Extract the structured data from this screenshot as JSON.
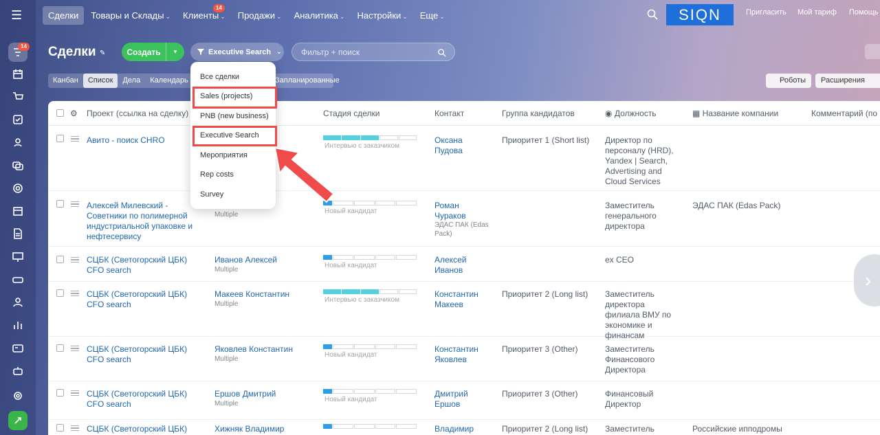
{
  "rail": {
    "badge": "14"
  },
  "topnav": {
    "items": [
      "Сделки",
      "Товары и Склады",
      "Клиенты",
      "Продажи",
      "Аналитика",
      "Настройки",
      "Еще"
    ],
    "clients_badge": "14",
    "logo": "SIQN",
    "invite": "Пригласить",
    "tariff": "Мой тариф",
    "help": "Помощь"
  },
  "header": {
    "title": "Сделки",
    "create": "Создать",
    "filter_preset": "Executive Search",
    "filter_placeholder": "Фильтр + поиск"
  },
  "views": [
    "Канбан",
    "Список",
    "Дела",
    "Календарь"
  ],
  "planned": "Запланированные",
  "robots": "Роботы",
  "extensions": "Расширения",
  "dropdown": {
    "items": [
      "Все сделки",
      "Sales (projects)",
      "PNB (new business)",
      "Executive Search",
      "Мероприятия",
      "Rep costs",
      "Survey"
    ]
  },
  "table": {
    "columns": [
      "Проект (ссылка на сделку)",
      "Стадия сделки",
      "Контакт",
      "Группа кандидатов",
      "Должность",
      "Название компании",
      "Комментарий (по ка"
    ],
    "rows": [
      {
        "project": "Авито - поиск CHRO",
        "candidate": "",
        "cand_sub": "",
        "stage": "Интервью с заказчиком",
        "contact": "Оксана Пудова",
        "contact_sub": "",
        "group": "Приоритет 1 (Short list)",
        "position": "Директор по персоналу (HRD), Yandex | Search, Advertising and Cloud Services",
        "company": ""
      },
      {
        "project": "Алексей Милевский - Советники по полимерной индустриальной упаковке и нефтесервису",
        "candidate": "",
        "cand_sub": "Multiple",
        "stage": "Новый кандидат",
        "contact": "Роман Чураков",
        "contact_sub": "ЭДАС ПАК (Edas Pack)",
        "group": "",
        "position": "Заместитель генерального директора",
        "company": "ЭДАС ПАК (Edas Pack)"
      },
      {
        "project": "СЦБК (Светогорский ЦБК) CFO search",
        "candidate": "Иванов Алексей",
        "cand_sub": "Multiple",
        "stage": "Новый кандидат",
        "contact": "Алексей Иванов",
        "contact_sub": "",
        "group": "",
        "position": "ex CEO",
        "company": ""
      },
      {
        "project": "СЦБК (Светогорский ЦБК) CFO search",
        "candidate": "Макеев Константин",
        "cand_sub": "Multiple",
        "stage": "Интервью с заказчиком",
        "contact": "Константин Макеев",
        "contact_sub": "",
        "group": "Приоритет 2 (Long list)",
        "position": "Заместитель директора филиала ВМУ по экономике и финансам",
        "company": ""
      },
      {
        "project": "СЦБК (Светогорский ЦБК) CFO search",
        "candidate": "Яковлев Константин",
        "cand_sub": "Multiple",
        "stage": "Новый кандидат",
        "contact": "Константин Яковлев",
        "contact_sub": "",
        "group": "Приоритет 3 (Other)",
        "position": "Заместитель Финансового Директора",
        "company": ""
      },
      {
        "project": "СЦБК (Светогорский ЦБК) CFO search",
        "candidate": "Ершов Дмитрий",
        "cand_sub": "Multiple",
        "stage": "Новый кандидат",
        "contact": "Дмитрий Ершов",
        "contact_sub": "",
        "group": "Приоритет 3 (Other)",
        "position": "Финансовый Директор",
        "company": ""
      },
      {
        "project": "СЦБК (Светогорский ЦБК) CFO",
        "candidate": "Хижняк Владимир",
        "cand_sub": "",
        "stage": "",
        "contact": "Владимир",
        "contact_sub": "",
        "group": "Приоритет 2 (Long list)",
        "position": "Заместитель",
        "company": "Российские ипподромы"
      }
    ]
  }
}
